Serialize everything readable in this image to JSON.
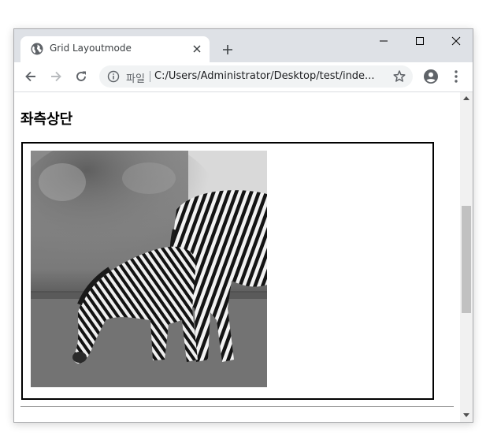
{
  "browser": {
    "tab_title": "Grid Layoutmode",
    "scheme_label": "파일",
    "url": "C:/Users/Administrator/Desktop/test/inde..."
  },
  "icons": {
    "favicon": "globe-icon",
    "tab_close": "close-icon",
    "new_tab": "plus-icon",
    "minimize": "minimize-icon",
    "maximize": "maximize-icon",
    "close": "close-icon",
    "back": "arrow-left-icon",
    "forward": "arrow-right-icon",
    "reload": "reload-icon",
    "site_info": "info-icon",
    "bookmark": "star-icon",
    "profile": "account-icon",
    "menu": "kebab-menu-icon"
  },
  "page": {
    "heading": "좌측상단"
  },
  "colors": {
    "titlebar_bg": "#dee1e6",
    "omnibox_bg": "#f1f3f4",
    "icon_dark": "#5f6368",
    "grid_border": "#000000"
  }
}
